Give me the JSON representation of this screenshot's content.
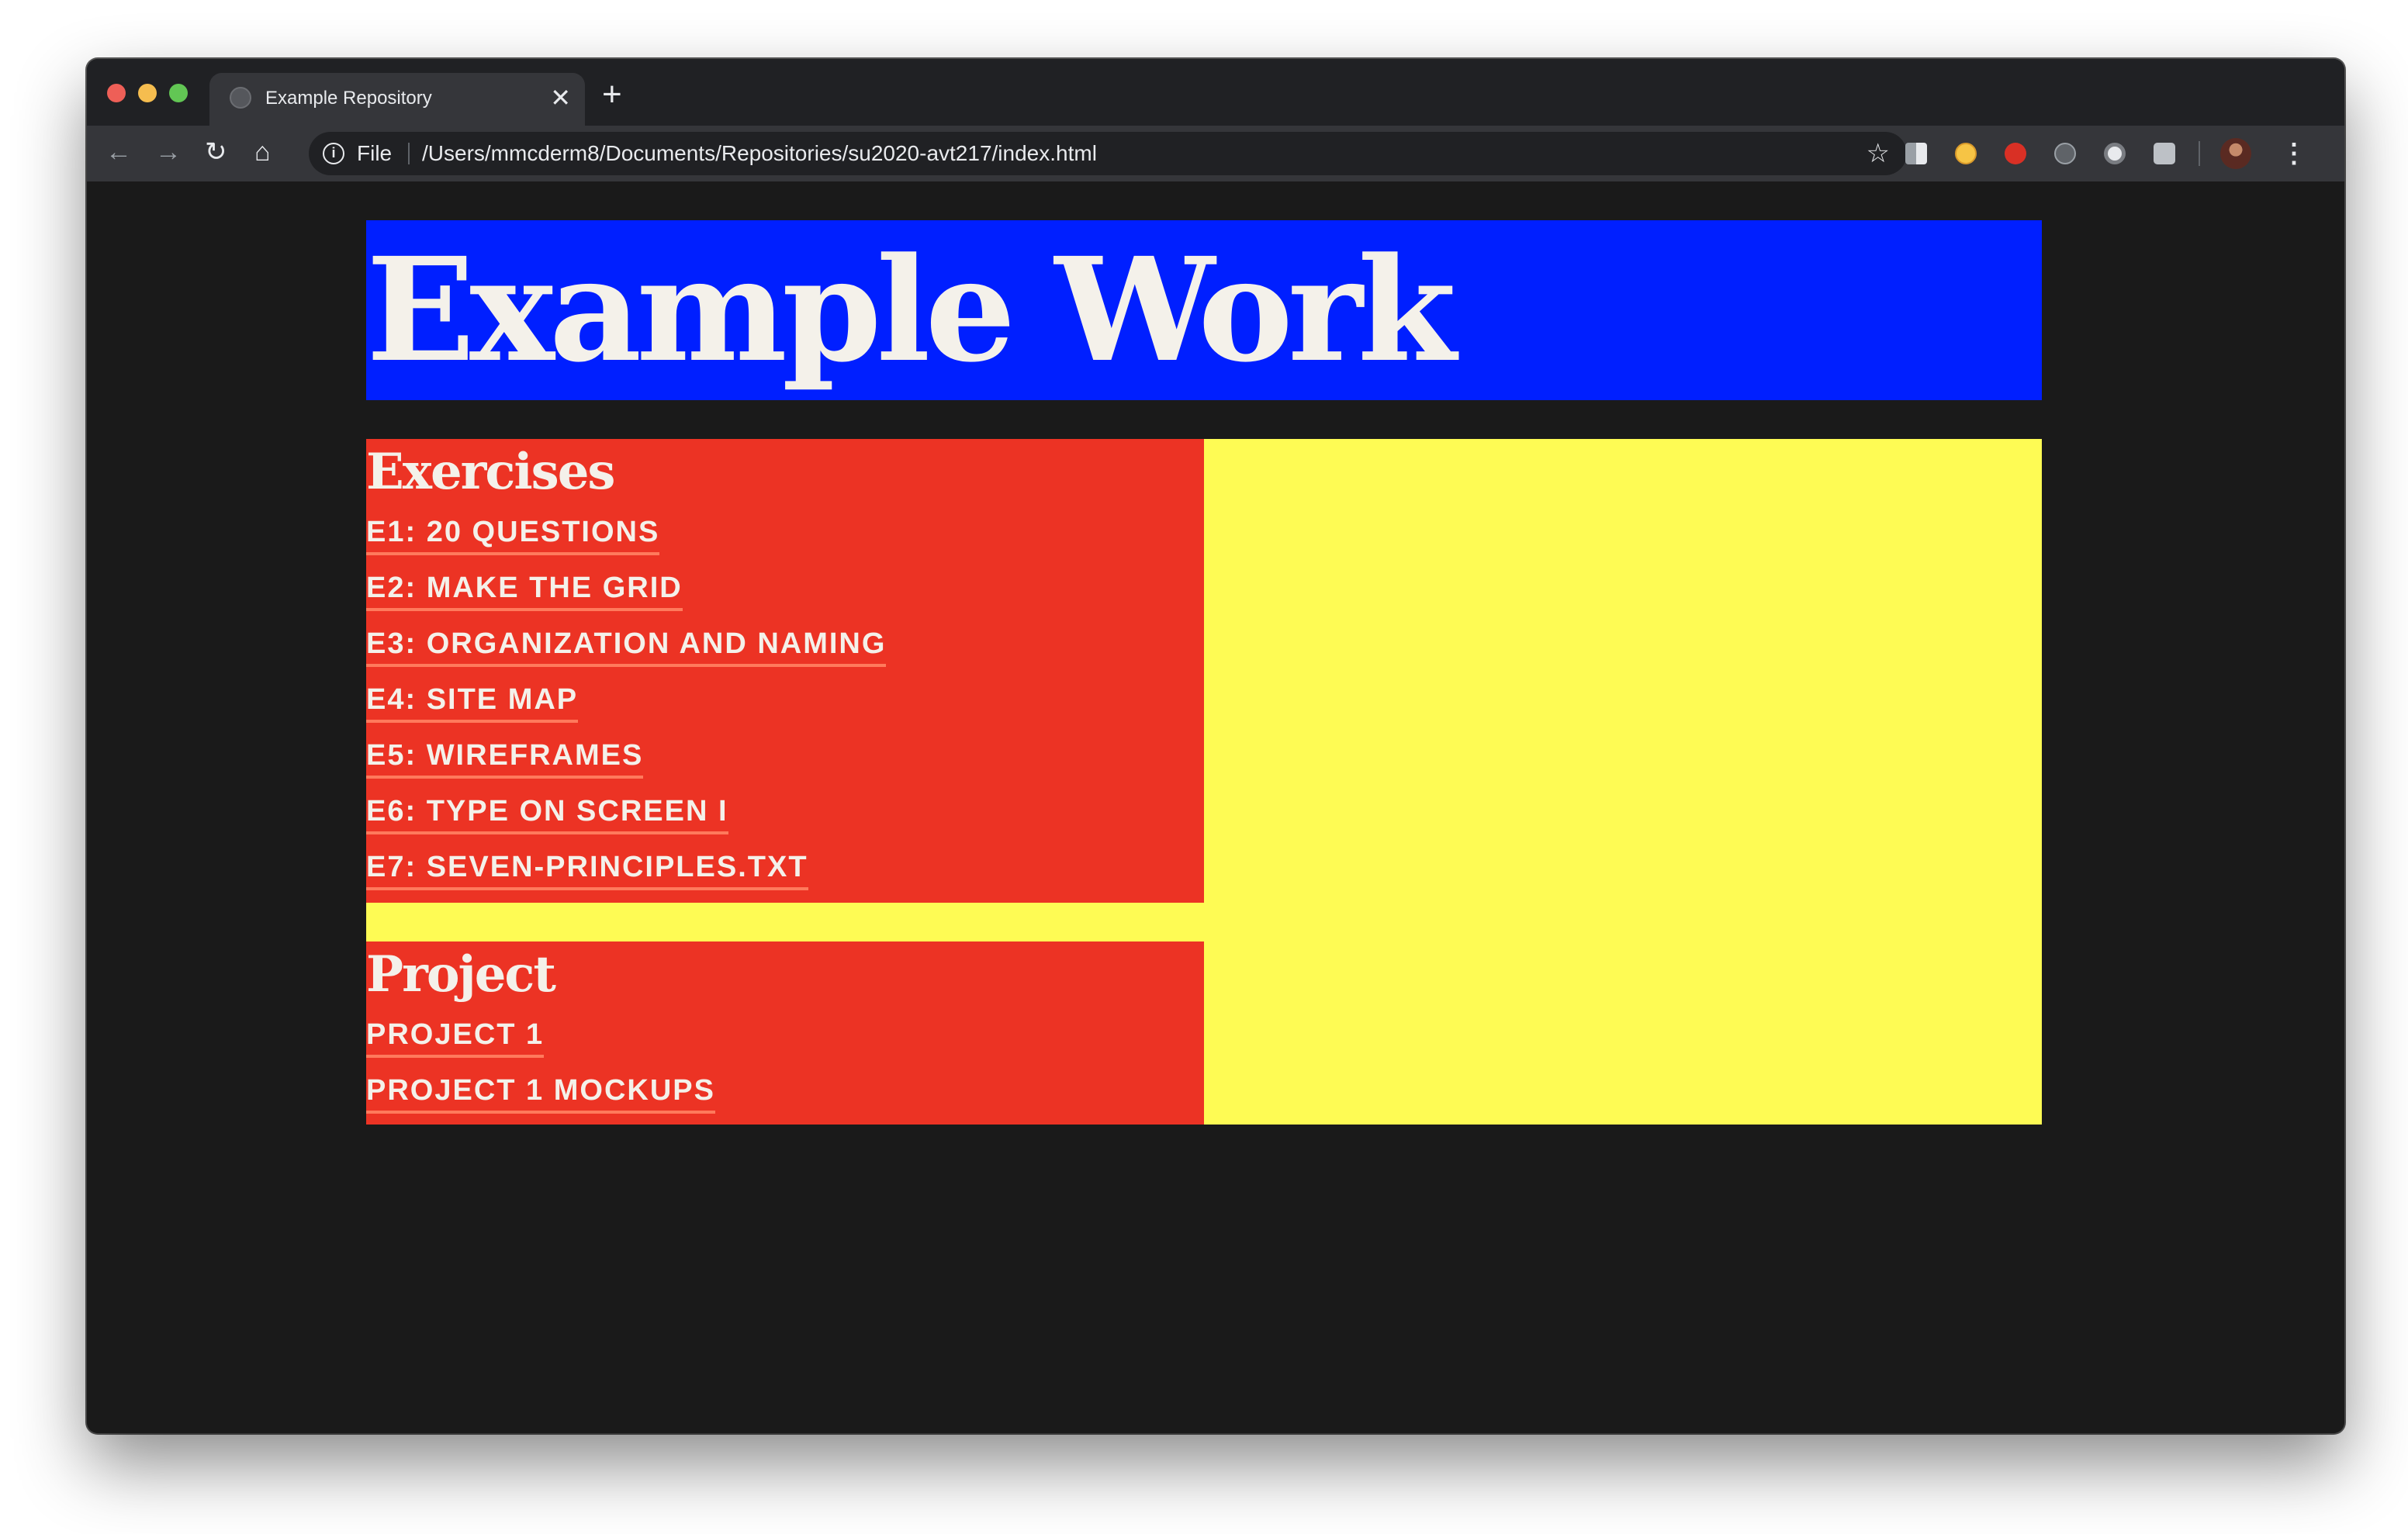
{
  "browser": {
    "tab": {
      "title": "Example Repository",
      "close_glyph": "✕"
    },
    "new_tab_glyph": "+",
    "nav": {
      "back": "←",
      "forward": "→",
      "reload": "↻",
      "home": "⌂"
    },
    "address": {
      "scheme_label": "File",
      "url": "/Users/mmcderm8/Documents/Repositories/su2020-avt217/index.html",
      "info_glyph": "i"
    },
    "bookmark_glyph": "☆",
    "menu_glyph": "⋮",
    "extensions": [
      "extension-icon",
      "emoji-extension-icon",
      "adblock-icon",
      "vpn-icon",
      "record-icon",
      "screenshot-icon"
    ]
  },
  "page": {
    "title": "Example Work",
    "colors": {
      "header": "#001fff",
      "sections": "#ec3324",
      "accent": "#fefb54",
      "background": "#1a1a1a",
      "text": "#f4f1ea"
    },
    "exercises": {
      "heading": "Exercises",
      "links": [
        {
          "label": "E1: 20 QUESTIONS"
        },
        {
          "label": "E2: MAKE THE GRID"
        },
        {
          "label": "E3: ORGANIZATION AND NAMING"
        },
        {
          "label": "E4: SITE MAP"
        },
        {
          "label": "E5: WIREFRAMES"
        },
        {
          "label": "E6: TYPE ON SCREEN I"
        },
        {
          "label": "E7: SEVEN-PRINCIPLES.TXT"
        }
      ]
    },
    "project": {
      "heading": "Project",
      "links": [
        {
          "label": "PROJECT 1"
        },
        {
          "label": "PROJECT 1 MOCKUPS"
        }
      ]
    }
  }
}
